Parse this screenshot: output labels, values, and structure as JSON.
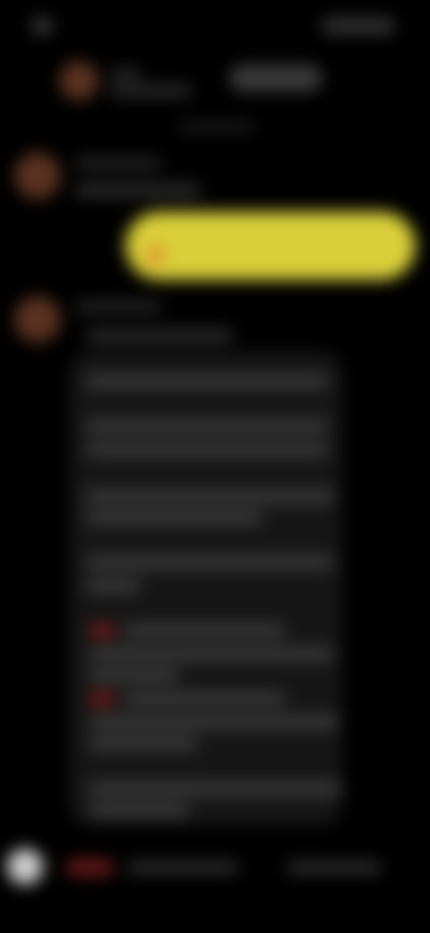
{
  "theme": {
    "background": "#000000",
    "user_bubble": "#d9cf3a",
    "contact_avatar": "#5a3220"
  },
  "note": "",
  "icons": {
    "contact_avatar": "avatar-icon",
    "attachment": "circle-icon"
  }
}
